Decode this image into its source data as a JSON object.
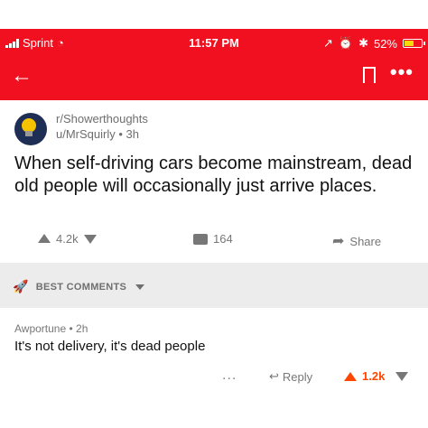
{
  "status_bar": {
    "carrier": "Sprint",
    "time": "11:57 PM",
    "battery": "52%"
  },
  "nav": {
    "back_icon": "←",
    "more_icon": "•••"
  },
  "post": {
    "subreddit": "r/Showerthoughts",
    "author_line": "u/MrSquirly • 3h",
    "title": "When self-driving cars become mainstream, dead old people will occasionally just arrive places.",
    "upvotes": "4.2k",
    "comments": "164",
    "share_label": "Share"
  },
  "sort": {
    "label": "BEST COMMENTS"
  },
  "comment": {
    "author_line": "Awportune • 2h",
    "body": "It's not delivery, it's dead people",
    "more": "...",
    "reply_label": "Reply",
    "score": "1.2k"
  },
  "colors": {
    "header_red": "#f0101f",
    "upvote_orange": "#ff4500"
  }
}
